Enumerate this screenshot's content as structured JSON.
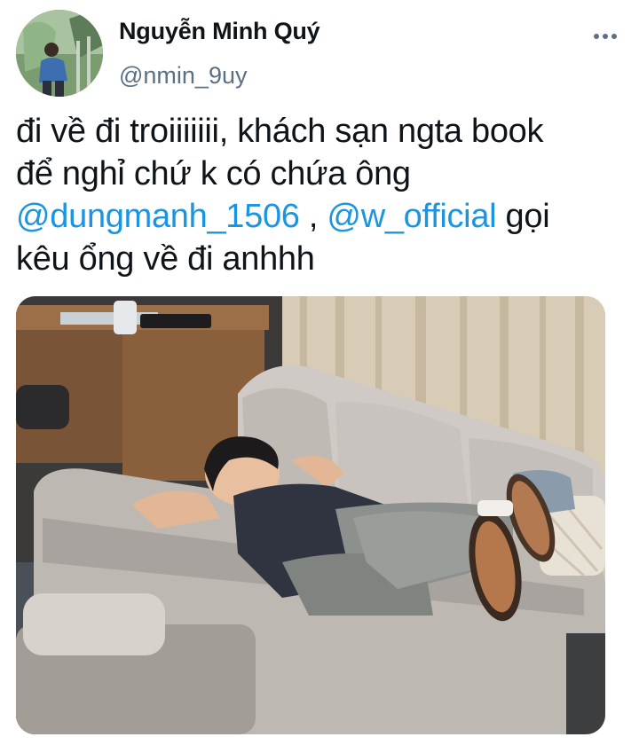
{
  "author": {
    "display_name": "Nguyễn Minh Quý",
    "handle": "@nmin_9uy",
    "avatar_icon": "profile-photo"
  },
  "more_menu": {
    "icon": "more-horizontal-icon",
    "glyph": "•••"
  },
  "tweet": {
    "line1": "đi về đi troiiiiiii, khách sạn ngta book",
    "line2": "để nghỉ chứ k có chứa ông",
    "mention1": "@dungmanh_1506",
    "sep": " , ",
    "mention2": "@w_official",
    "after_mention": " gọi",
    "line4": "kêu ổng về đi anhhh"
  },
  "colors": {
    "text": "#0f1419",
    "secondary": "#5b7083",
    "mention": "#1b95e0"
  },
  "media": {
    "description_icon": "photo-person-sleeping-on-sofa"
  }
}
